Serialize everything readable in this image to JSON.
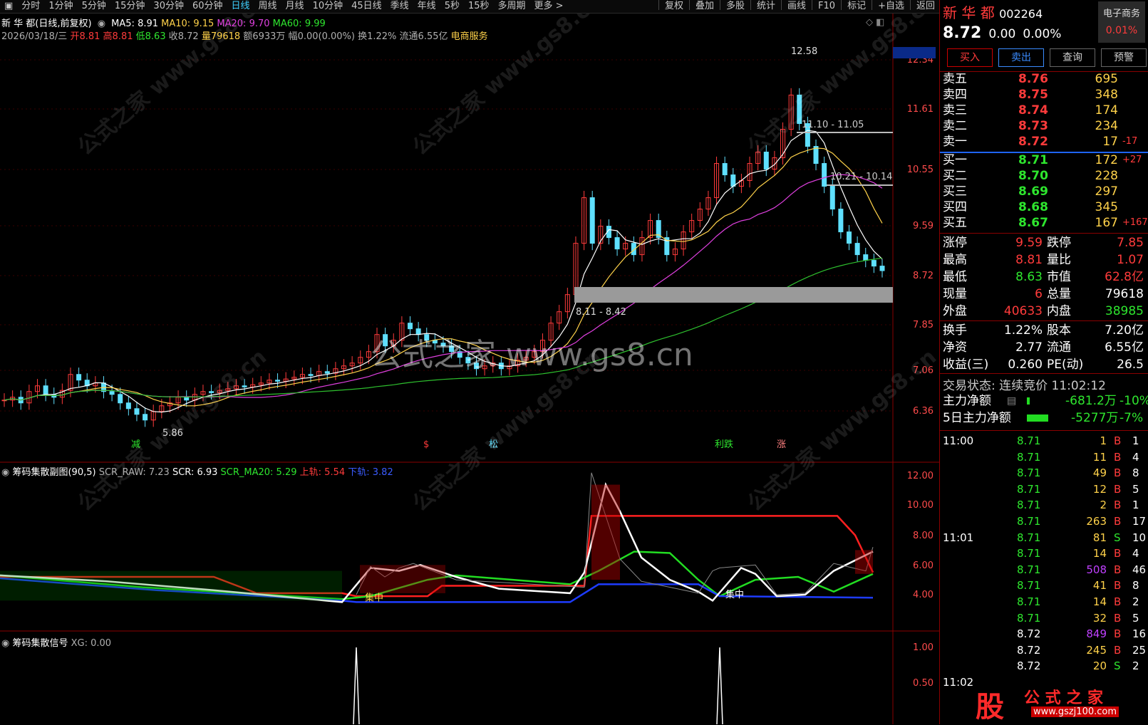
{
  "toolbar": {
    "tabs": [
      "分时",
      "1分钟",
      "5分钟",
      "15分钟",
      "30分钟",
      "60分钟",
      "日线",
      "周线",
      "月线",
      "10分钟",
      "45日线",
      "季线",
      "年线",
      "5秒",
      "15秒",
      "多周期",
      "更多 >"
    ],
    "active_tab": "日线",
    "tools": [
      "复权",
      "叠加",
      "多股",
      "统计",
      "画线",
      "F10",
      "标记",
      "+自选",
      "返回"
    ]
  },
  "chart_header": {
    "title": "新 华 都(日线,前复权)",
    "ma5": "MA5: 8.91",
    "ma10": "MA10: 9.15",
    "ma20": "MA20: 9.70",
    "ma60": "MA60: 9.99",
    "date": "2026/03/18/三",
    "open": "开8.81",
    "high": "高8.81",
    "low": "低8.63",
    "close": "收8.72",
    "vol": "量79618",
    "amount": "额6933万",
    "range": "幅0.00(0.00%)",
    "turnover": "换1.22%",
    "float": "流通6.55亿",
    "sector": "电商服务"
  },
  "main_axis": {
    "labels": [
      "12.34",
      "11.61",
      "10.55",
      "9.59",
      "8.72",
      "7.85",
      "7.06",
      "6.36"
    ]
  },
  "annotations": {
    "peak": "12.58",
    "low": "5.86",
    "band1": "11.10 - 11.05",
    "band2": "10.21 - 10.14",
    "band3": "8.11 - 8.42",
    "watermark": "公式之家 www.gs8.cn",
    "wm_small": "公式之家 www.gs8.cn",
    "m1": "减",
    "m2": "$",
    "m3": "松",
    "m4": "利跌",
    "m5": "涨"
  },
  "sub1": {
    "title": "筹码集散副图(90,5)",
    "scr_raw": "SCR_RAW: 7.23",
    "scr": "SCR: 6.93",
    "ma20": "SCR_MA20: 5.29",
    "upper": "上轨: 5.54",
    "lower": "下轨: 3.82",
    "axis": [
      "12.00",
      "10.00",
      "8.00",
      "6.00",
      "4.00"
    ],
    "tag1": "集中",
    "tag2": "集中"
  },
  "sub2": {
    "title": "筹码集散信号",
    "xg": "XG: 0.00",
    "axis": [
      "1.00",
      "0.50"
    ]
  },
  "quote": {
    "name": "新 华 都",
    "code": "002264",
    "industry": "电子商务",
    "ind_pct": "0.01%",
    "price": "8.72",
    "change": "0.00",
    "pct": "0.00%",
    "buttons": [
      "买入",
      "卖出",
      "查询",
      "预警"
    ],
    "asks": [
      {
        "label": "卖五",
        "price": "8.76",
        "vol": "695",
        "ex": ""
      },
      {
        "label": "卖四",
        "price": "8.75",
        "vol": "348",
        "ex": ""
      },
      {
        "label": "卖三",
        "price": "8.74",
        "vol": "174",
        "ex": ""
      },
      {
        "label": "卖二",
        "price": "8.73",
        "vol": "234",
        "ex": ""
      },
      {
        "label": "卖一",
        "price": "8.72",
        "vol": "17",
        "ex": "-17"
      }
    ],
    "bids": [
      {
        "label": "买一",
        "price": "8.71",
        "vol": "172",
        "ex": "+27"
      },
      {
        "label": "买二",
        "price": "8.70",
        "vol": "228",
        "ex": ""
      },
      {
        "label": "买三",
        "price": "8.69",
        "vol": "297",
        "ex": ""
      },
      {
        "label": "买四",
        "price": "8.68",
        "vol": "345",
        "ex": ""
      },
      {
        "label": "买五",
        "price": "8.67",
        "vol": "167",
        "ex": "+167"
      }
    ],
    "stats": [
      {
        "l1": "涨停",
        "v1": "9.59",
        "l2": "跌停",
        "v2": "7.85"
      },
      {
        "l1": "最高",
        "v1": "8.81",
        "l2": "量比",
        "v2": "1.07"
      },
      {
        "l1": "最低",
        "v1": "8.63",
        "l2": "市值",
        "v2": "62.8亿"
      },
      {
        "l1": "现量",
        "v1": "6",
        "l2": "总量",
        "v2": "79618"
      },
      {
        "l1": "外盘",
        "v1": "40633",
        "l2": "内盘",
        "v2": "38985"
      }
    ],
    "stats2": [
      {
        "l1": "换手",
        "v1": "1.22%",
        "l2": "股本",
        "v2": "7.20亿"
      },
      {
        "l1": "净资",
        "v1": "2.77",
        "l2": "流通",
        "v2": "6.55亿"
      },
      {
        "l1": "收益(三)",
        "v1": "0.260",
        "l2": "PE(动)",
        "v2": "26.5"
      }
    ],
    "status": "交易状态: 连续竞价 11:02:12",
    "mainflow": {
      "label": "主力净额",
      "value": "-681.2万",
      "pct": "-10%"
    },
    "flow5": {
      "label": "5日主力净额",
      "value": "-5277万",
      "pct": "-7%"
    },
    "ticks": [
      {
        "t": "11:00",
        "p": "8.71",
        "v": "1",
        "s": "B",
        "n": "1"
      },
      {
        "t": "",
        "p": "8.71",
        "v": "11",
        "s": "B",
        "n": "4"
      },
      {
        "t": "",
        "p": "8.71",
        "v": "49",
        "s": "B",
        "n": "8"
      },
      {
        "t": "",
        "p": "8.71",
        "v": "12",
        "s": "B",
        "n": "5"
      },
      {
        "t": "",
        "p": "8.71",
        "v": "2",
        "s": "B",
        "n": "1"
      },
      {
        "t": "",
        "p": "8.71",
        "v": "263",
        "s": "B",
        "n": "17"
      },
      {
        "t": "11:01",
        "p": "8.71",
        "v": "81",
        "s": "S",
        "n": "10"
      },
      {
        "t": "",
        "p": "8.71",
        "v": "14",
        "s": "B",
        "n": "4"
      },
      {
        "t": "",
        "p": "8.71",
        "v": "508",
        "s": "B",
        "n": "46"
      },
      {
        "t": "",
        "p": "8.71",
        "v": "41",
        "s": "B",
        "n": "8"
      },
      {
        "t": "",
        "p": "8.71",
        "v": "14",
        "s": "B",
        "n": "2"
      },
      {
        "t": "",
        "p": "8.71",
        "v": "32",
        "s": "B",
        "n": "5"
      },
      {
        "t": "",
        "p": "8.72",
        "v": "849",
        "s": "B",
        "n": "16"
      },
      {
        "t": "",
        "p": "8.72",
        "v": "245",
        "s": "B",
        "n": "25"
      },
      {
        "t": "",
        "p": "8.72",
        "v": "20",
        "s": "S",
        "n": "2"
      },
      {
        "t": "11:02",
        "p": "",
        "v": "",
        "s": "",
        "n": ""
      }
    ],
    "logo_text": "公 式 之 家",
    "logo_url": "www.gszj100.com",
    "logo_glyph": "股"
  }
}
